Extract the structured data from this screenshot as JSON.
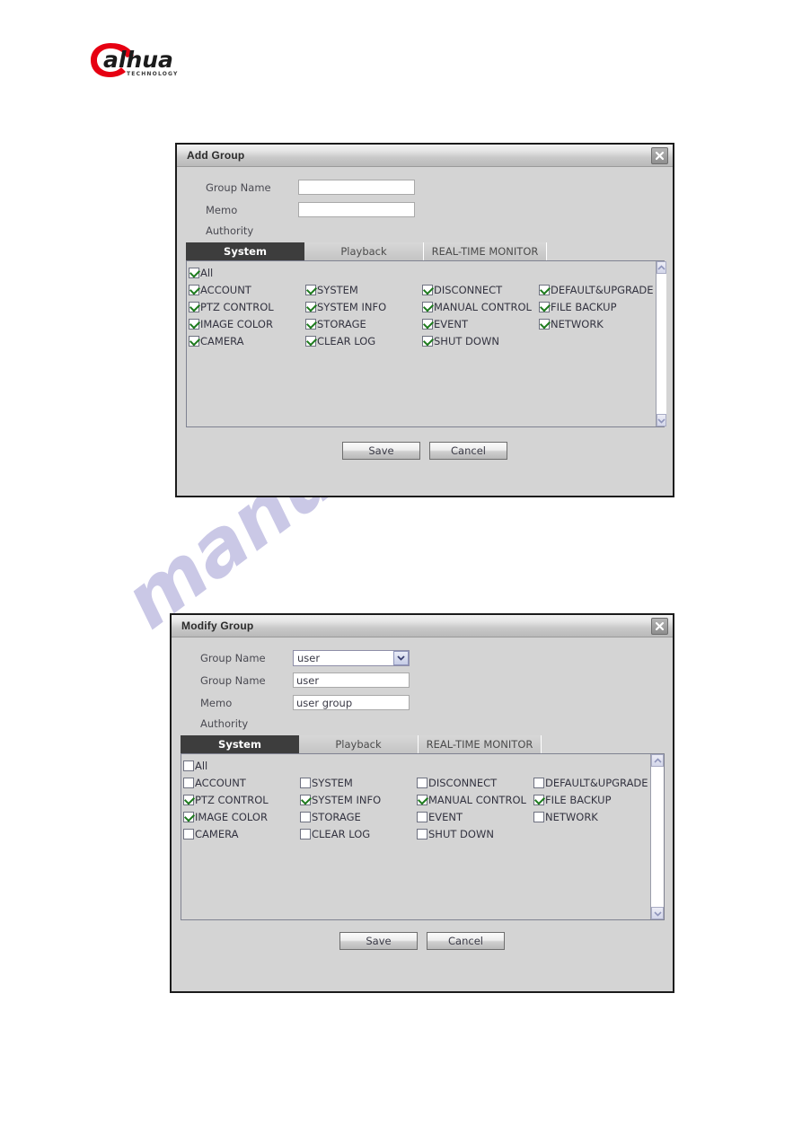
{
  "brand": {
    "logo_name": "dahua-logo",
    "logo_text": "alhua",
    "logo_subtext": "TECHNOLOGY",
    "logo_color": "#1b1b1b",
    "logo_accent": "#e60012"
  },
  "watermark": {
    "text": "manualshive.com",
    "color": "#b6b4dd"
  },
  "permission_labels": {
    "all": "All",
    "col1": [
      "ACCOUNT",
      "PTZ CONTROL",
      "IMAGE COLOR",
      "CAMERA"
    ],
    "col2": [
      "SYSTEM",
      "SYSTEM INFO",
      "STORAGE",
      "CLEAR LOG"
    ],
    "col3": [
      "DISCONNECT",
      "MANUAL CONTROL",
      "EVENT",
      "SHUT DOWN"
    ],
    "col4": [
      "DEFAULT&UPGRADE",
      "FILE BACKUP",
      "NETWORK"
    ]
  },
  "add_group": {
    "title": "Add Group",
    "close_icon": "close-icon",
    "fields": {
      "group_name_label": "Group Name",
      "group_name_value": "",
      "group_name_placeholder": "",
      "memo_label": "Memo",
      "memo_value": "",
      "memo_placeholder": "",
      "authority_label": "Authority"
    },
    "tabs": [
      {
        "label": "System",
        "active": true
      },
      {
        "label": "Playback",
        "active": false
      },
      {
        "label": "REAL-TIME MONITOR",
        "active": false
      }
    ],
    "permissions": {
      "all_checked": true,
      "col1_checked": [
        true,
        true,
        true,
        true
      ],
      "col2_checked": [
        true,
        true,
        true,
        true
      ],
      "col3_checked": [
        true,
        true,
        true,
        true
      ],
      "col4_checked": [
        true,
        true,
        true
      ]
    },
    "buttons": {
      "save": "Save",
      "cancel": "Cancel"
    }
  },
  "modify_group": {
    "title": "Modify Group",
    "close_icon": "close-icon",
    "fields": {
      "group_select_label": "Group Name",
      "group_select_value": "user",
      "group_name_label": "Group Name",
      "group_name_value": "user",
      "memo_label": "Memo",
      "memo_value": "user group",
      "authority_label": "Authority"
    },
    "tabs": [
      {
        "label": "System",
        "active": true
      },
      {
        "label": "Playback",
        "active": false
      },
      {
        "label": "REAL-TIME MONITOR",
        "active": false
      }
    ],
    "permissions": {
      "all_checked": false,
      "col1_checked": [
        false,
        true,
        true,
        false
      ],
      "col2_checked": [
        false,
        true,
        false,
        false
      ],
      "col3_checked": [
        false,
        true,
        false,
        false
      ],
      "col4_checked": [
        false,
        true,
        false
      ]
    },
    "buttons": {
      "save": "Save",
      "cancel": "Cancel"
    }
  }
}
